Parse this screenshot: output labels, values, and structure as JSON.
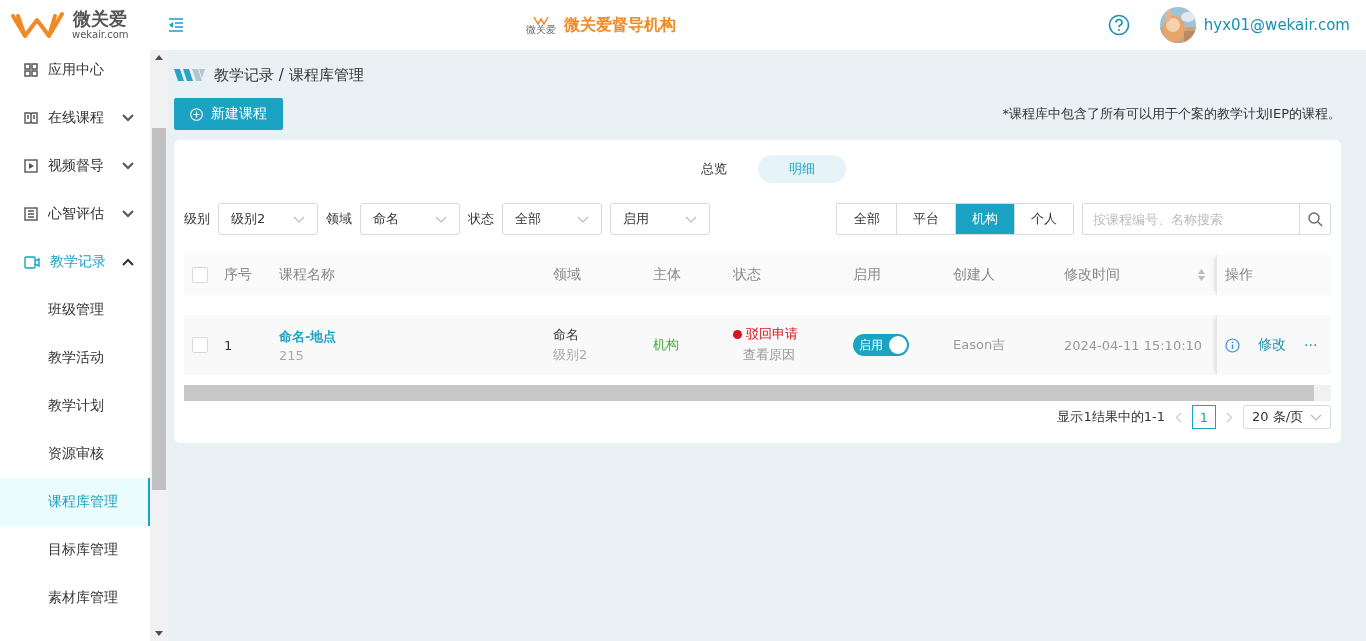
{
  "header": {
    "logo_name": "微关爱",
    "logo_domain": "wekair.com",
    "org_logo_text": "微关爱",
    "org_title": "微关爱督导机构",
    "user": "hyx01@wekair.com"
  },
  "sidebar": {
    "items": [
      {
        "label": "应用中心"
      },
      {
        "label": "在线课程",
        "expanded": false
      },
      {
        "label": "视频督导",
        "expanded": false
      },
      {
        "label": "心智评估",
        "expanded": false
      },
      {
        "label": "教学记录",
        "expanded": true,
        "children": [
          {
            "label": "班级管理",
            "selected": false
          },
          {
            "label": "教学活动",
            "selected": false
          },
          {
            "label": "教学计划",
            "selected": false
          },
          {
            "label": "资源审核",
            "selected": false
          },
          {
            "label": "课程库管理",
            "selected": true
          },
          {
            "label": "目标库管理",
            "selected": false
          },
          {
            "label": "素材库管理",
            "selected": false
          }
        ]
      }
    ]
  },
  "breadcrumb": "教学记录 / 课程库管理",
  "new_button": "新建课程",
  "note": "*课程库中包含了所有可以用于个案的教学计划IEP的课程。",
  "view_tabs": [
    {
      "label": "总览",
      "selected": false
    },
    {
      "label": "明细",
      "selected": true
    }
  ],
  "filters": [
    {
      "label": "级别",
      "value": "级别2"
    },
    {
      "label": "领域",
      "value": "命名"
    },
    {
      "label": "状态",
      "value": "全部"
    },
    {
      "value": "启用"
    }
  ],
  "scope_tabs": [
    {
      "label": "全部",
      "selected": false
    },
    {
      "label": "平台",
      "selected": false
    },
    {
      "label": "机构",
      "selected": true
    },
    {
      "label": "个人",
      "selected": false
    }
  ],
  "search": {
    "placeholder": "按课程编号、名称搜索"
  },
  "table": {
    "select_all": {
      "checked": false
    },
    "columns": [
      {
        "label": "序号"
      },
      {
        "label": "课程名称"
      },
      {
        "label": "领域"
      },
      {
        "label": "主体"
      },
      {
        "label": "状态"
      },
      {
        "label": "启用"
      },
      {
        "label": "创建人"
      },
      {
        "label": "修改时间",
        "sortable": true
      },
      {
        "label": "操作"
      }
    ],
    "rows": [
      {
        "checked": false,
        "index": "1",
        "name": "命名-地点",
        "code": "215",
        "domain": "命名",
        "level": "级别2",
        "owner": "机构",
        "status": "驳回申请",
        "color": "#d4141f",
        "status_link": "查看原因",
        "toggle_label": "启用",
        "enabled": true,
        "creator": "Eason吉",
        "modified": "2024-04-11 15:10:10",
        "edit": "修改",
        "more": "···"
      }
    ]
  },
  "pagination": {
    "summary": "显示1结果中的1-1",
    "pages": [
      {
        "label": "1",
        "selected": true
      }
    ],
    "page_size": "20 条/页"
  }
}
